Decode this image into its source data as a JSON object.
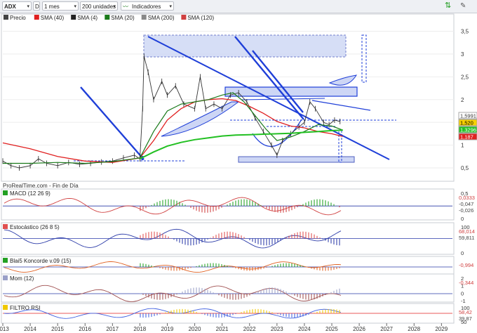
{
  "toolbar": {
    "symbol": "ADX",
    "mode": "D",
    "period": "1 mes",
    "units": "200 unidades",
    "indicators_label": "Indicadores"
  },
  "legend": [
    {
      "label": "Precio",
      "color": "#444444"
    },
    {
      "label": "SMA (40)",
      "color": "#e02020"
    },
    {
      "label": "SMA (4)",
      "color": "#222222"
    },
    {
      "label": "SMA (20)",
      "color": "#1a7a1a"
    },
    {
      "label": "SMA (200)",
      "color": "#888888"
    },
    {
      "label": "SMA (120)",
      "color": "#d04040"
    }
  ],
  "watermark": "ProRealTime.com - Fin de Día",
  "colors": {
    "accent_blue": "#1f3fd8",
    "green": "#22c022",
    "red": "#e02020",
    "box_fill": "#cdd6f5"
  },
  "chart_data": [
    {
      "type": "line",
      "x_years": [
        "2013",
        "2014",
        "2015",
        "2016",
        "2017",
        "2018",
        "2019",
        "2020",
        "2021",
        "2022",
        "2023",
        "2024",
        "2025",
        "2026",
        "2027",
        "2028",
        "2029"
      ],
      "xlim": [
        2013.0,
        2029.4
      ],
      "ylim": [
        0.3,
        3.6
      ],
      "y_ticks": [
        "0,5",
        "1",
        "1,5",
        "2",
        "2,5",
        "3",
        "3,5"
      ],
      "y_tick_values": [
        0.5,
        1,
        1.5,
        2,
        2.5,
        3,
        3.5
      ],
      "price_labels": [
        "1,5991",
        "1,520",
        "1,3296",
        "1,187"
      ],
      "series": [
        {
          "name": "Precio",
          "x": [
            2013.0,
            2013.3,
            2013.6,
            2014.0,
            2014.3,
            2014.6,
            2015.0,
            2015.4,
            2015.8,
            2016.2,
            2016.6,
            2017.0,
            2017.4,
            2017.8,
            2018.0,
            2018.1,
            2018.15,
            2018.3,
            2018.5,
            2018.8,
            2019.0,
            2019.3,
            2019.6,
            2020.0,
            2020.2,
            2020.4,
            2020.7,
            2021.0,
            2021.3,
            2021.6,
            2021.9,
            2022.2,
            2022.5,
            2022.8,
            2023.0,
            2023.2,
            2023.5,
            2023.8,
            2024.0,
            2024.2,
            2024.4,
            2024.7,
            2024.9,
            2025.1,
            2025.3
          ],
          "y": [
            0.65,
            0.55,
            0.5,
            0.55,
            0.7,
            0.6,
            0.55,
            0.62,
            0.58,
            0.6,
            0.63,
            0.65,
            0.72,
            0.78,
            0.7,
            1.8,
            2.95,
            2.6,
            2.0,
            2.4,
            2.1,
            2.3,
            1.9,
            1.8,
            2.5,
            1.8,
            1.9,
            1.8,
            2.1,
            2.15,
            1.95,
            1.6,
            1.3,
            1.0,
            0.78,
            1.1,
            1.25,
            1.4,
            1.5,
            1.95,
            1.8,
            1.5,
            1.45,
            1.55,
            1.52
          ]
        },
        {
          "name": "SMA (40)",
          "x": [
            2013.0,
            2014.0,
            2015.0,
            2016.0,
            2017.0,
            2018.0,
            2018.5,
            2019.0,
            2019.5,
            2020.0,
            2020.5,
            2021.0,
            2021.5,
            2022.0,
            2022.5,
            2023.0,
            2023.5,
            2024.0,
            2024.5,
            2025.0,
            2025.4
          ],
          "y": [
            1.05,
            0.92,
            0.75,
            0.65,
            0.62,
            0.72,
            1.1,
            1.55,
            1.8,
            1.95,
            2.0,
            2.02,
            1.98,
            1.85,
            1.7,
            1.52,
            1.42,
            1.38,
            1.3,
            1.25,
            1.19
          ]
        },
        {
          "name": "SMA (20)",
          "x": [
            2013.0,
            2014.0,
            2015.0,
            2016.0,
            2017.0,
            2018.0,
            2018.5,
            2019.0,
            2019.5,
            2020.0,
            2020.5,
            2021.0,
            2021.4,
            2021.8,
            2022.2,
            2022.6,
            2023.0,
            2023.5,
            2024.0,
            2024.5,
            2025.0,
            2025.4
          ],
          "y": [
            0.6,
            0.6,
            0.62,
            0.6,
            0.64,
            0.72,
            1.3,
            1.75,
            1.9,
            1.95,
            2.0,
            2.1,
            2.15,
            1.95,
            1.65,
            1.35,
            1.1,
            1.18,
            1.3,
            1.45,
            1.42,
            1.33
          ]
        },
        {
          "name": "SMA (120)",
          "x": [
            2018.0,
            2018.5,
            2019.0,
            2019.5,
            2020.0,
            2020.5,
            2021.0,
            2021.5,
            2022.0,
            2022.5,
            2023.0,
            2023.5,
            2024.0,
            2024.5,
            2025.0,
            2025.4
          ],
          "y": [
            0.7,
            0.85,
            0.98,
            1.06,
            1.12,
            1.16,
            1.2,
            1.22,
            1.23,
            1.24,
            1.25,
            1.26,
            1.28,
            1.3,
            1.32,
            1.33
          ]
        }
      ]
    },
    {
      "type": "bar",
      "name": "MACD (12 26 9)",
      "y_ticks": [
        "0,5",
        "0"
      ],
      "labels": [
        "0,0333",
        "-0,047",
        "-0,026"
      ]
    },
    {
      "type": "line",
      "name": "Estocástico (26 8 5)",
      "y_ticks": [
        "100",
        "0"
      ],
      "labels": [
        "68,014",
        "59,811"
      ]
    },
    {
      "type": "area",
      "name": "Blai5 Koncorde v.09 (15)",
      "labels": [
        "-0,994"
      ]
    },
    {
      "type": "area",
      "name": "Mom (12)",
      "y_ticks": [
        "2",
        "1",
        "0",
        "-1"
      ],
      "labels": [
        "-0,344"
      ]
    },
    {
      "type": "bar",
      "name": "FILTRO RSI",
      "y_ticks": [
        "100",
        "50"
      ],
      "labels": [
        "58,42",
        "39,87"
      ]
    }
  ]
}
